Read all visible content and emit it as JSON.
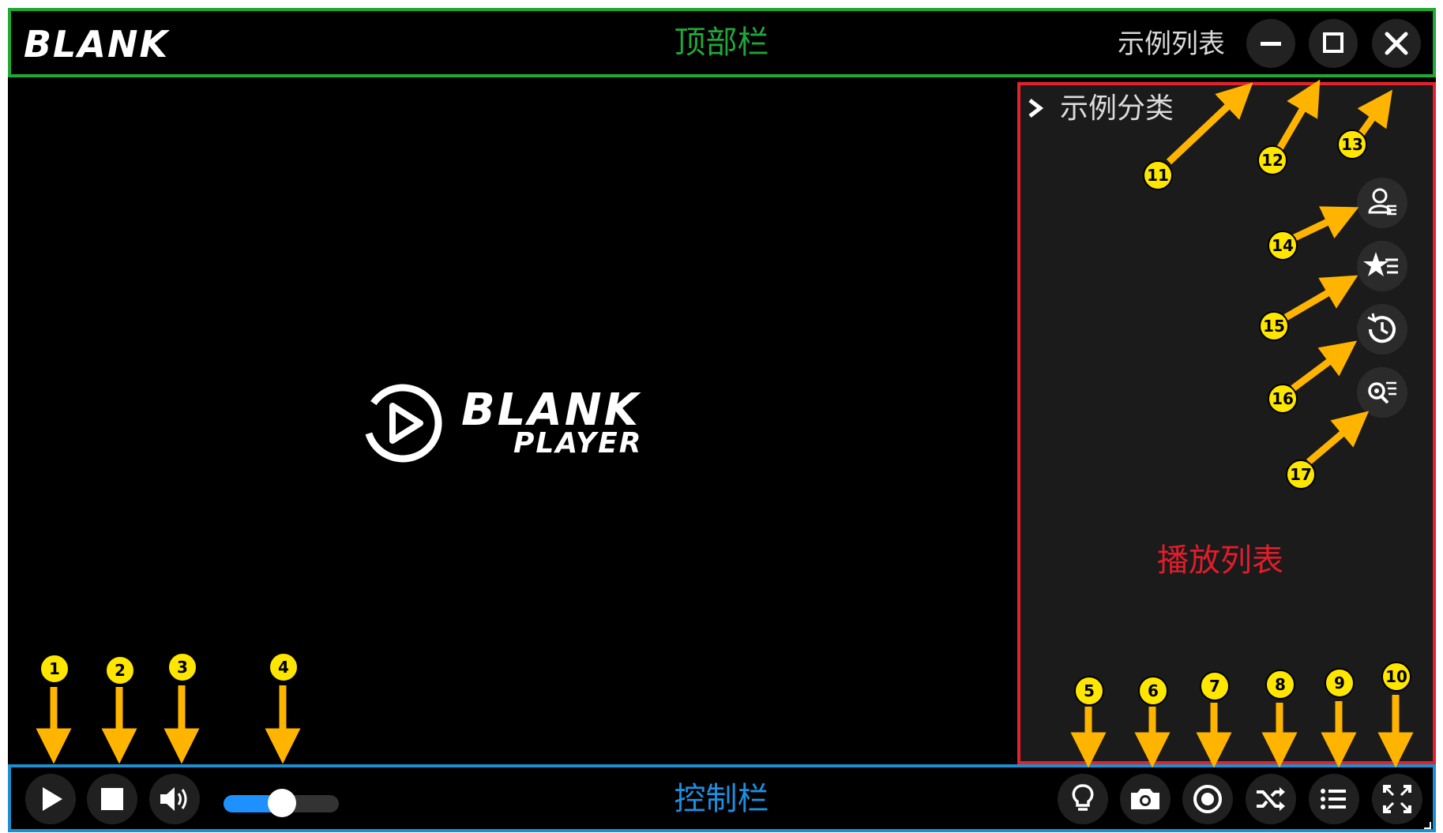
{
  "top_bar": {
    "logo_text": "BLANK",
    "label": "顶部栏",
    "list_title": "示例列表",
    "buttons": {
      "minimize": "minimize-icon",
      "maximize": "maximize-icon",
      "close": "close-icon"
    }
  },
  "player": {
    "brand_line1": "BLANK",
    "brand_line2": "PLAYER"
  },
  "playlist": {
    "category_label": "示例分类",
    "title": "播放列表",
    "side_buttons": [
      "user-list-icon",
      "star-list-icon",
      "history-icon",
      "search-list-icon"
    ]
  },
  "control_bar": {
    "label": "控制栏",
    "left_buttons": [
      "play-icon",
      "stop-icon",
      "volume-icon"
    ],
    "volume_level": 0.5,
    "right_buttons": [
      "lightbulb-icon",
      "camera-icon",
      "record-icon",
      "shuffle-icon",
      "list-icon",
      "fullscreen-icon"
    ]
  },
  "annotations": [
    "1",
    "2",
    "3",
    "4",
    "5",
    "6",
    "7",
    "8",
    "9",
    "10",
    "11",
    "12",
    "13",
    "14",
    "15",
    "16",
    "17"
  ],
  "colors": {
    "top_border": "#1faa33",
    "control_border": "#1d8fd1",
    "playlist_border": "#e4222d",
    "badge": "#ffe600",
    "arrow": "#ffb400"
  }
}
